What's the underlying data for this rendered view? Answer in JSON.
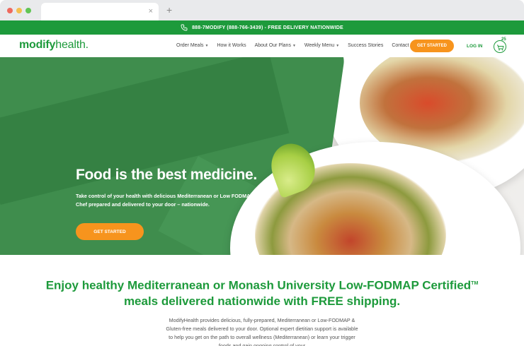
{
  "browser": {
    "tab_close": "×",
    "new_tab": "+"
  },
  "topbar": {
    "text": "888-7MODIFY (888-766-3439) - FREE DELIVERY NATIONWIDE",
    "icon": "phone-icon"
  },
  "nav": {
    "logo_bold": "modify",
    "logo_light": "health.",
    "items": [
      {
        "label": "Order Meals",
        "caret": true
      },
      {
        "label": "How it Works",
        "caret": false
      },
      {
        "label": "About Our Plans",
        "caret": true
      },
      {
        "label": "Weekly Menu",
        "caret": true
      },
      {
        "label": "Success Stories",
        "caret": false
      },
      {
        "label": "Contact Us",
        "caret": false
      }
    ],
    "cta": "GET STARTED",
    "login": "LOG IN",
    "cart_count": "25",
    "cart_icon": "cart-icon"
  },
  "hero": {
    "title": "Food is the best medicine.",
    "subtitle": "Take control of your health with delicious Mediterranean or Low FODMAP meals. Chef prepared and delivered to your door – nationwide.",
    "cta": "GET STARTED"
  },
  "intro": {
    "heading_part1": "Enjoy healthy Mediterranean or Monash University Low-FODMAP Certified",
    "heading_tm": "TM",
    "heading_part2": " meals delivered nationwide with FREE shipping.",
    "body": "ModifyHealth provides delicious, fully-prepared, Mediterranean or Low-FODMAP & Gluten-free meals delivered to your door. Optional expert dietitian support is available to help you get on the path to overall wellness (Mediterranean) or learn your trigger foods and gain ongoing control of your"
  },
  "colors": {
    "brand_green": "#1d9a3b",
    "cta_orange": "#f7941d"
  }
}
